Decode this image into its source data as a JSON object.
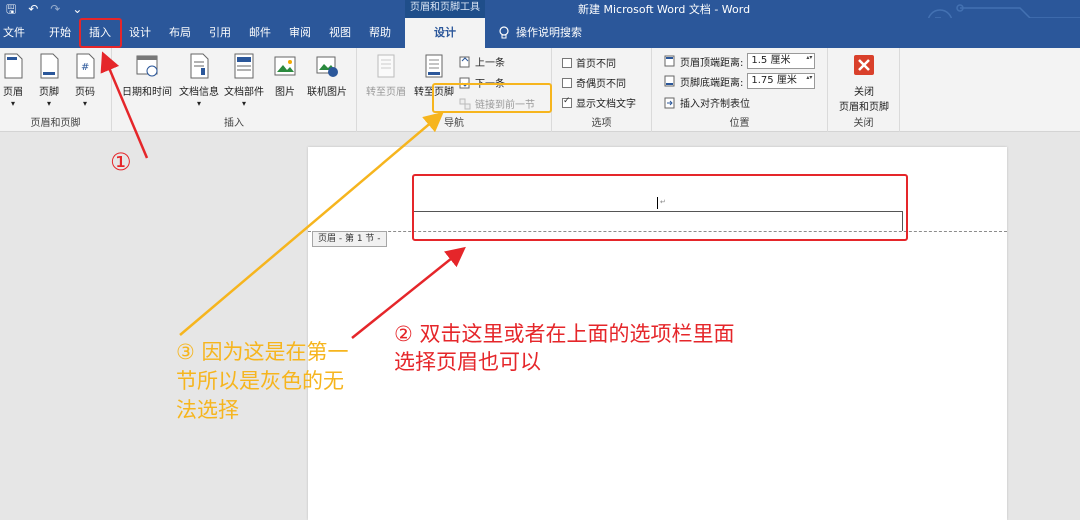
{
  "titlebar": {
    "context_tool": "页眉和页脚工具",
    "document_title": "新建 Microsoft Word 文档 - Word",
    "qat_save": "🖫",
    "qat_undo": "↶",
    "qat_redo": "↷",
    "qat_more": "⌄"
  },
  "tabs": {
    "file": "文件",
    "home": "开始",
    "insert": "插入",
    "design": "设计",
    "layout": "布局",
    "references": "引用",
    "mailings": "邮件",
    "review": "审阅",
    "view": "视图",
    "help": "帮助",
    "hf_design": "设计",
    "tell_me": "操作说明搜索"
  },
  "ribbon": {
    "hf_group": {
      "label": "页眉和页脚",
      "header": "页眉",
      "footer": "页脚",
      "page_number": "页码"
    },
    "insert_group": {
      "label": "插入",
      "date_time": "日期和时间",
      "doc_info": "文档信息",
      "quick_parts": "文档部件",
      "pictures": "图片",
      "online_pictures": "联机图片"
    },
    "nav_group": {
      "label": "导航",
      "goto_header": "转至页眉",
      "goto_footer": "转至页脚",
      "previous": "上一条",
      "next": "下一条",
      "link_previous": "链接到前一节"
    },
    "options_group": {
      "label": "选项",
      "different_first": "首页不同",
      "different_odd_even": "奇偶页不同",
      "show_doc_text": "显示文档文字"
    },
    "position_group": {
      "label": "位置",
      "header_top": "页眉顶端距离:",
      "header_top_value": "1.5 厘米",
      "footer_bottom": "页脚底端距离:",
      "footer_bottom_value": "1.75 厘米",
      "insert_align_tab": "插入对齐制表位"
    },
    "close_group": {
      "label": "关闭",
      "close_line1": "关闭",
      "close_line2": "页眉和页脚"
    }
  },
  "document": {
    "header_tag": "页眉 - 第 1 节 -",
    "para_mark": "↵"
  },
  "annotations": {
    "step1": "①",
    "step2_line1": "②  双击这里或者在上面的选项栏里面",
    "step2_line2": "选择页眉也可以",
    "step3_line1": "③ 因为这是在第一",
    "step3_line2": "节所以是灰色的无",
    "step3_line3": "法选择"
  },
  "colors": {
    "accent": "#2b579a",
    "annotation_red": "#e5262a",
    "annotation_yellow": "#f6b51e"
  }
}
